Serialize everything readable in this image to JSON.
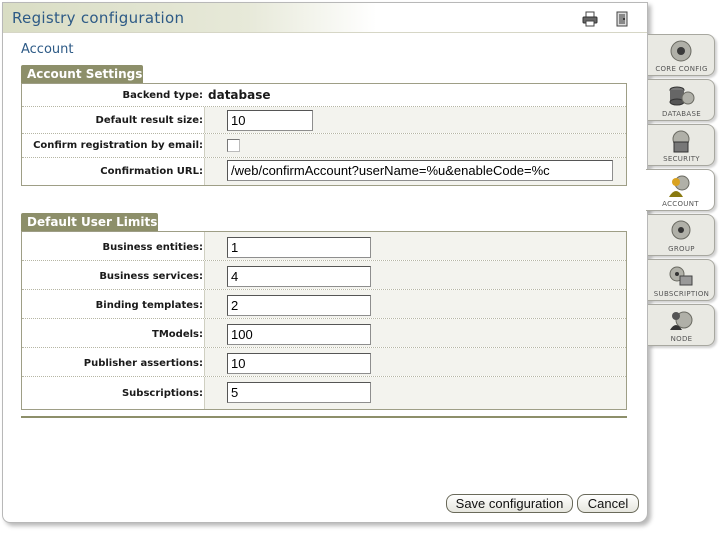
{
  "window": {
    "title": "Registry configuration"
  },
  "toolbar": {
    "print_icon": "printer-icon",
    "exit_icon": "exit-door-icon"
  },
  "page": {
    "heading": "Account"
  },
  "account_settings": {
    "legend": "Account Settings",
    "backend_type": {
      "label": "Backend type:",
      "value": "database"
    },
    "default_result_size": {
      "label": "Default result size:",
      "value": "10"
    },
    "confirm_registration": {
      "label": "Confirm registration by email:",
      "checked": false
    },
    "confirmation_url": {
      "label": "Confirmation URL:",
      "value": "/web/confirmAccount?userName=%u&enableCode=%c"
    }
  },
  "default_user_limits": {
    "legend": "Default User Limits",
    "rows": [
      {
        "label": "Business entities:",
        "value": "1"
      },
      {
        "label": "Business services:",
        "value": "4"
      },
      {
        "label": "Binding templates:",
        "value": "2"
      },
      {
        "label": "TModels:",
        "value": "100"
      },
      {
        "label": "Publisher assertions:",
        "value": "10"
      },
      {
        "label": "Subscriptions:",
        "value": "5"
      }
    ]
  },
  "buttons": {
    "save": "Save configuration",
    "cancel": "Cancel"
  },
  "tabs": [
    {
      "label": "CORE CONFIG",
      "icon": "gear-icon",
      "active": false
    },
    {
      "label": "DATABASE",
      "icon": "database-icon",
      "active": false
    },
    {
      "label": "SECURITY",
      "icon": "lock-icon",
      "active": false
    },
    {
      "label": "ACCOUNT",
      "icon": "user-account-icon",
      "active": true
    },
    {
      "label": "GROUP",
      "icon": "group-icon",
      "active": false
    },
    {
      "label": "SUBSCRIPTION",
      "icon": "subscription-icon",
      "active": false
    },
    {
      "label": "NODE",
      "icon": "node-icon",
      "active": false
    }
  ],
  "colors": {
    "title_text": "#2d5a86",
    "legend_bg": "#8d8f6a",
    "value_cell_bg": "#f3f3ee"
  }
}
